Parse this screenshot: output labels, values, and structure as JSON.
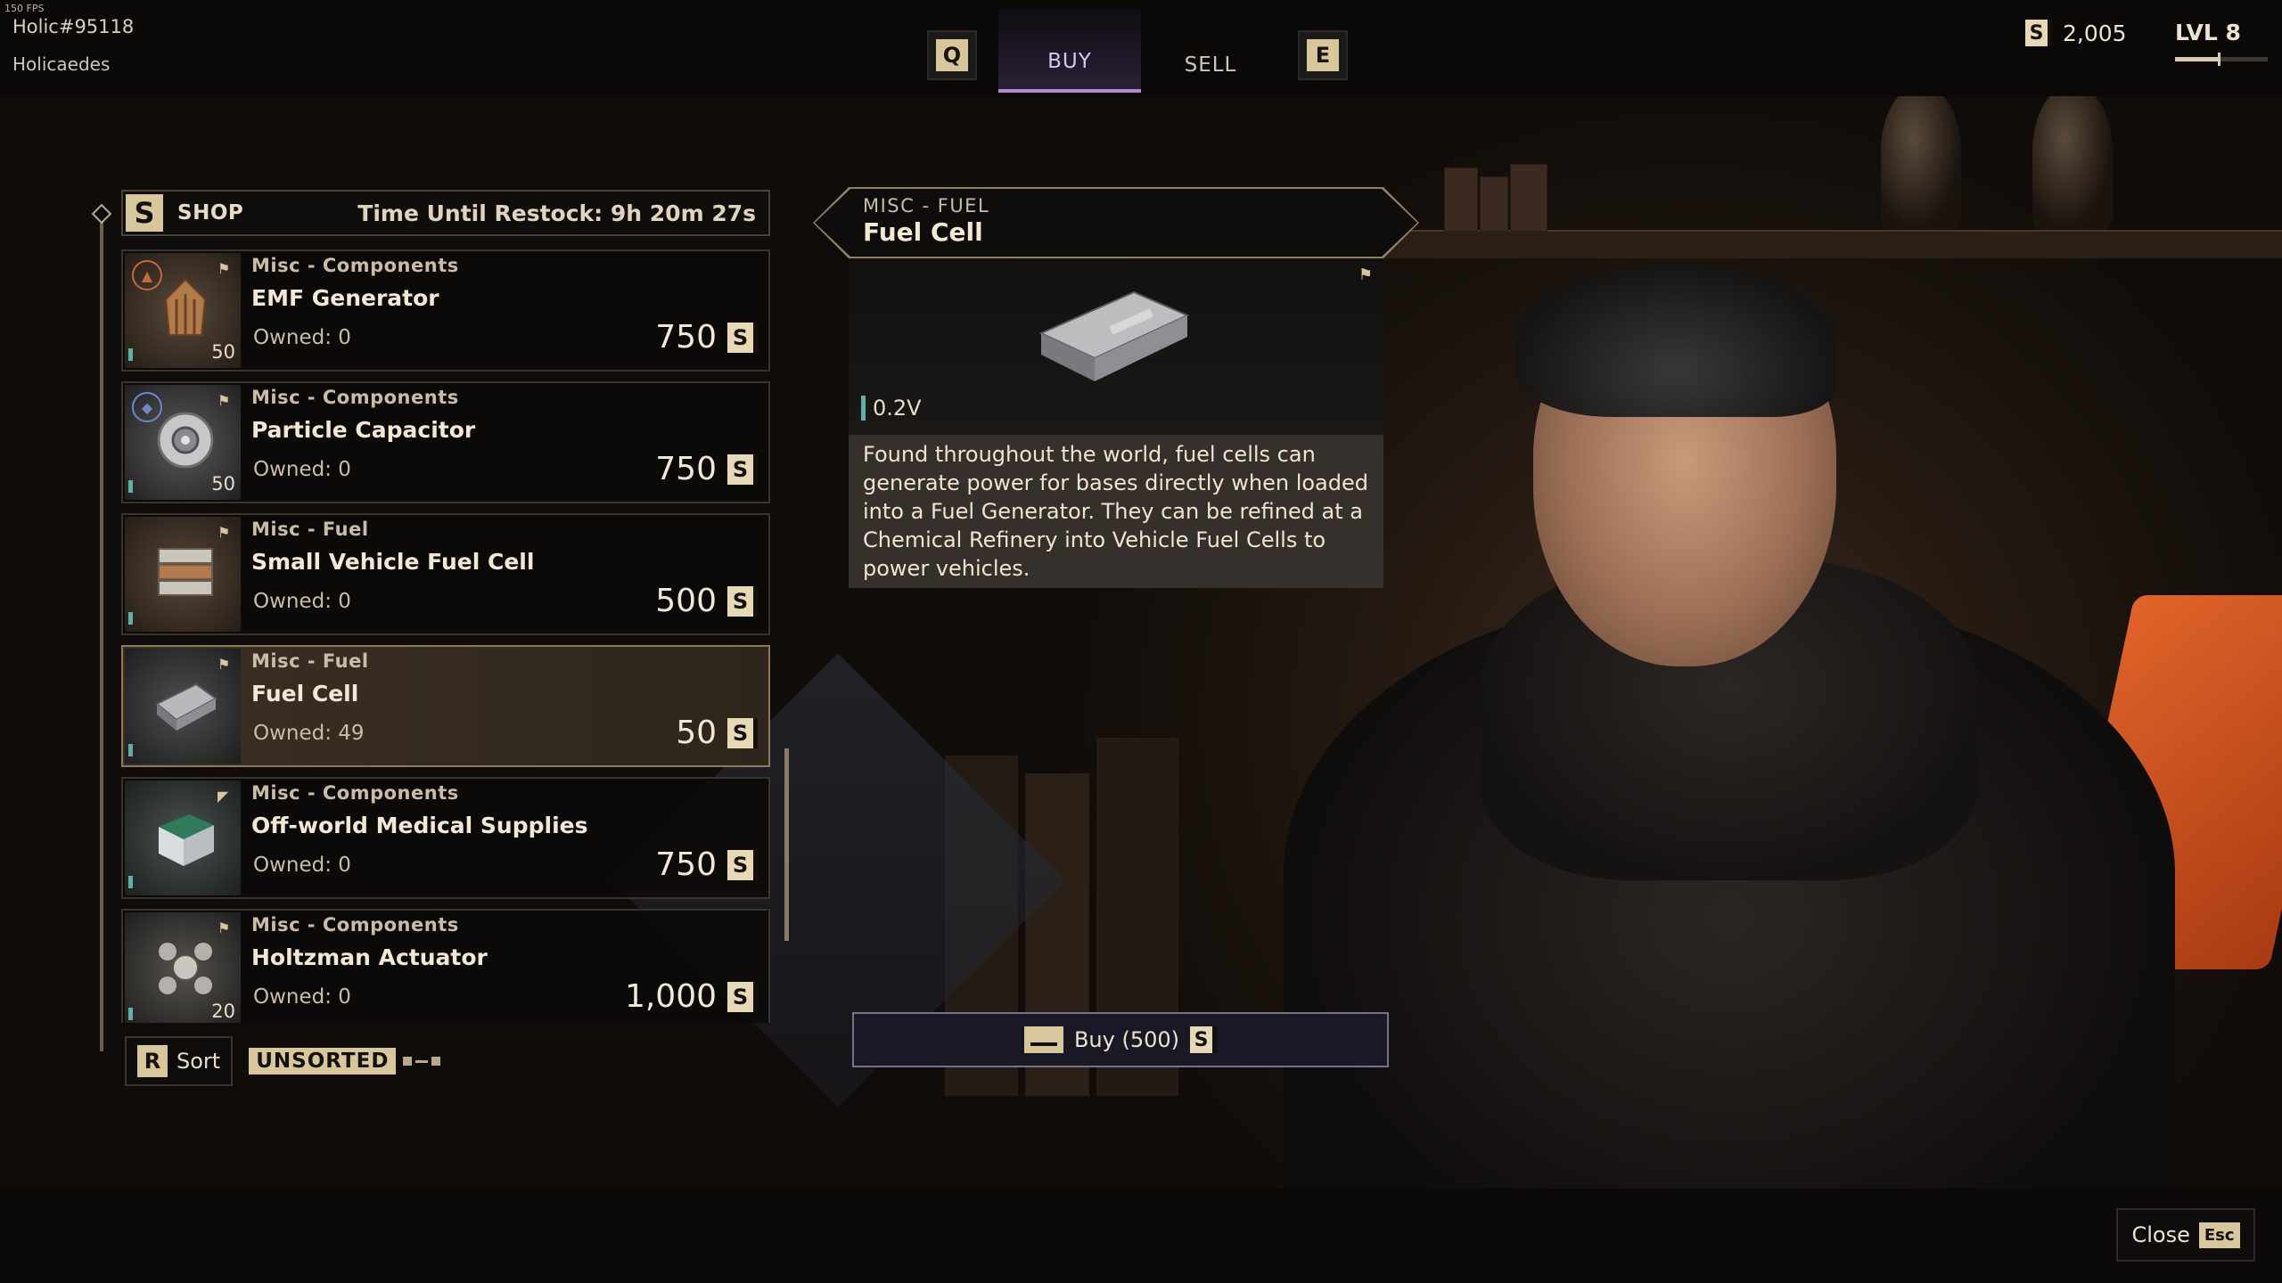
{
  "hud": {
    "fps": "150 FPS",
    "user_id": "Holic#95118",
    "user_name": "Holicaedes",
    "currency": "2,005",
    "level": "LVL 8",
    "level_progress": 0.47
  },
  "tabs": {
    "left_key": "Q",
    "right_key": "E",
    "buy": "BUY",
    "sell": "SELL",
    "active": "BUY"
  },
  "shop": {
    "logo": "S",
    "title": "SHOP",
    "restock": "Time Until Restock: 9h 20m 27s",
    "items": [
      {
        "category": "Misc - Components",
        "name": "EMF Generator",
        "owned": "Owned: 0",
        "price": "750",
        "stack": "50",
        "icon": "emf-generator-icon"
      },
      {
        "category": "Misc - Components",
        "name": "Particle Capacitor",
        "owned": "Owned: 0",
        "price": "750",
        "stack": "50",
        "icon": "particle-capacitor-icon"
      },
      {
        "category": "Misc - Fuel",
        "name": "Small Vehicle Fuel Cell",
        "owned": "Owned: 0",
        "price": "500",
        "stack": "",
        "icon": "vehicle-fuel-cell-icon"
      },
      {
        "category": "Misc - Fuel",
        "name": "Fuel Cell",
        "owned": "Owned: 49",
        "price": "50",
        "stack": "",
        "icon": "fuel-cell-icon",
        "selected": true
      },
      {
        "category": "Misc - Components",
        "name": "Off-world Medical Supplies",
        "owned": "Owned: 0",
        "price": "750",
        "stack": "",
        "icon": "medical-supplies-icon"
      },
      {
        "category": "Misc - Components",
        "name": "Holtzman Actuator",
        "owned": "Owned: 0",
        "price": "1,000",
        "stack": "20",
        "icon": "holtzman-actuator-icon"
      }
    ]
  },
  "sort": {
    "key": "R",
    "label": "Sort",
    "mode": "UNSORTED"
  },
  "detail": {
    "category": "MISC - FUEL",
    "name": "Fuel Cell",
    "volume": "0.2V",
    "description": "Found throughout the world, fuel cells can generate power for bases directly when loaded into a Fuel Generator. They can be refined at a Chemical Refinery into Vehicle Fuel Cells to power vehicles."
  },
  "buy_button": "Buy (500)",
  "close": {
    "label": "Close",
    "key": "Esc"
  },
  "colors": {
    "accent_purple": "#b08ad8",
    "gold": "#d9c79c",
    "volume_bar": "#5fb0a6"
  }
}
